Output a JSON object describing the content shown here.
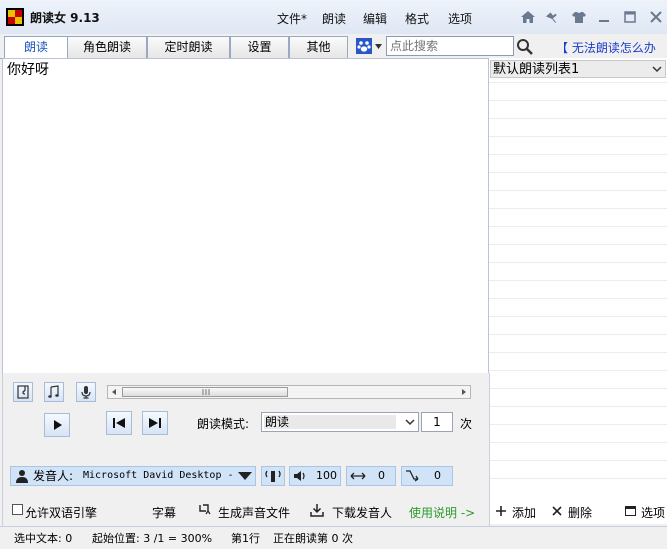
{
  "app": {
    "title": "朗读女 9.13"
  },
  "menu": [
    "文件*",
    "朗读",
    "编辑",
    "格式",
    "选项"
  ],
  "toolbar_icons": [
    "home-icon",
    "pin-icon",
    "shirt-icon",
    "minimize-icon",
    "maximize-icon",
    "close-icon"
  ],
  "tabs": [
    "朗读",
    "角色朗读",
    "定时朗读",
    "设置",
    "其他"
  ],
  "search": {
    "placeholder": "点此搜索"
  },
  "help_link": "【 无法朗读怎么办",
  "editor": {
    "text": "你好呀"
  },
  "playlist": {
    "selected": "默认朗读列表1"
  },
  "player": {
    "mode_label": "朗读模式:",
    "mode_value": "朗读",
    "count": "1",
    "count_unit": "次"
  },
  "voice": {
    "label": "发音人:",
    "value": "Microsoft David Desktop -",
    "volume": "100",
    "speed": "0",
    "pitch": "0"
  },
  "options": {
    "bilingual": "允许双语引擎"
  },
  "actions": {
    "subtitle": "字幕",
    "generate_audio": "生成声音文件",
    "download_voice": "下载发音人",
    "instructions": "使用说明 ->",
    "add": "添加",
    "delete": "删除",
    "options": "选项"
  },
  "status": {
    "selected_text": "选中文本: 0",
    "start_position": "起始位置: 3 /1 = 300%",
    "line": "第1行",
    "reading": "正在朗读第 0 次"
  },
  "colors": {
    "accent": "#1a56b8",
    "link": "#1a3ccc",
    "instructions": "#2a9a2a"
  }
}
